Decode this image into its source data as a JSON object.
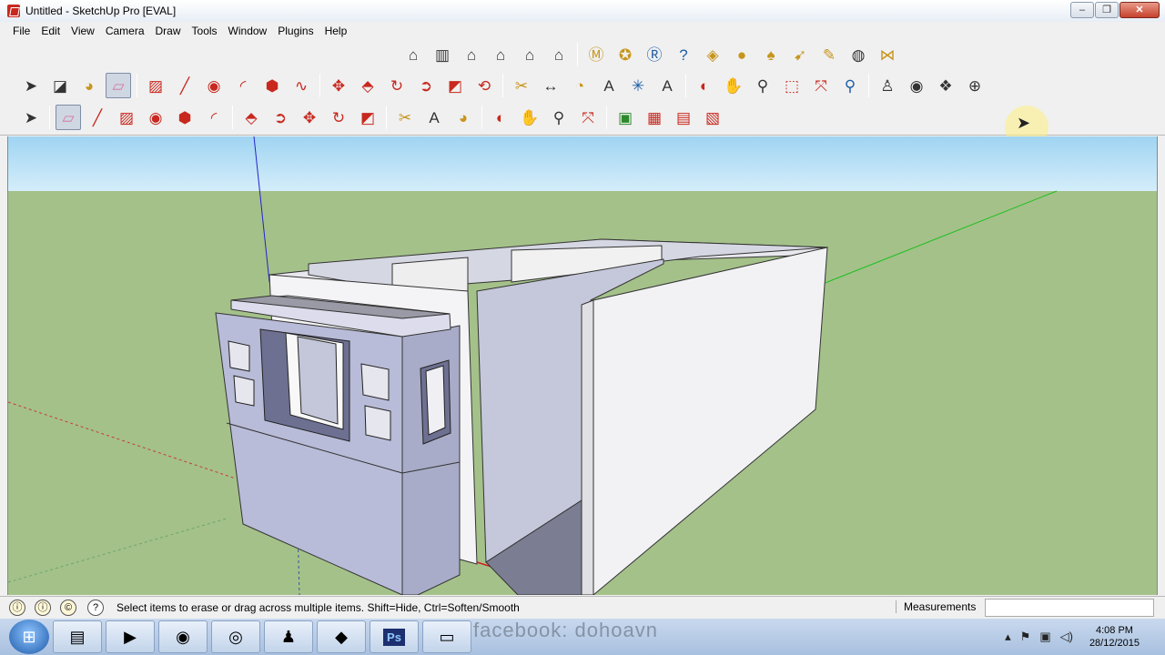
{
  "window": {
    "title": "Untitled - SketchUp Pro [EVAL]",
    "minimize": "–",
    "maximize": "❐",
    "close": "✕"
  },
  "menu": [
    "File",
    "Edit",
    "View",
    "Camera",
    "Draw",
    "Tools",
    "Window",
    "Plugins",
    "Help"
  ],
  "toolbar_top": [
    {
      "icon": "warehouse-icon",
      "glyph": "⌂",
      "c": "ic-dark"
    },
    {
      "icon": "component-icon",
      "glyph": "▥",
      "c": "ic-dark"
    },
    {
      "icon": "home-view-icon",
      "glyph": "⌂",
      "c": "ic-dark"
    },
    {
      "icon": "front-view-icon",
      "glyph": "⌂",
      "c": "ic-dark"
    },
    {
      "icon": "back-view-icon",
      "glyph": "⌂",
      "c": "ic-dark"
    },
    {
      "icon": "side-view-icon",
      "glyph": "⌂",
      "c": "ic-dark"
    },
    "sep",
    {
      "icon": "m-plugin-icon",
      "glyph": "Ⓜ",
      "c": "ic-gold"
    },
    {
      "icon": "tag-plugin-icon",
      "glyph": "✪",
      "c": "ic-gold"
    },
    {
      "icon": "r-plugin-icon",
      "glyph": "Ⓡ",
      "c": "ic-blue"
    },
    {
      "icon": "help-plugin-icon",
      "glyph": "?",
      "c": "ic-blue"
    },
    {
      "icon": "label-plugin-icon",
      "glyph": "◈",
      "c": "ic-gold"
    },
    {
      "icon": "sun-plugin-icon",
      "glyph": "●",
      "c": "ic-gold"
    },
    {
      "icon": "lamp-plugin-icon",
      "glyph": "♠",
      "c": "ic-gold"
    },
    {
      "icon": "pointer-plugin-icon",
      "glyph": "➹",
      "c": "ic-gold"
    },
    {
      "icon": "light-plugin-icon",
      "glyph": "✎",
      "c": "ic-gold"
    },
    {
      "icon": "sphere-plugin-icon",
      "glyph": "◍",
      "c": "ic-dark"
    },
    {
      "icon": "bridge-plugin-icon",
      "glyph": "⋈",
      "c": "ic-gold"
    }
  ],
  "toolbar_main": [
    {
      "icon": "select-arrow-icon",
      "glyph": "➤",
      "c": "ic-dark"
    },
    {
      "icon": "make-component-icon",
      "glyph": "◪",
      "c": "ic-dark"
    },
    {
      "icon": "paint-bucket-icon",
      "glyph": "◕",
      "c": "ic-gold"
    },
    {
      "icon": "eraser-icon",
      "glyph": "▱",
      "c": "ic-pink",
      "active": true
    },
    "sep",
    {
      "icon": "rectangle-icon",
      "glyph": "▨",
      "c": "ic-red"
    },
    {
      "icon": "pencil-line-icon",
      "glyph": "╱",
      "c": "ic-red"
    },
    {
      "icon": "circle-icon",
      "glyph": "◉",
      "c": "ic-red"
    },
    {
      "icon": "arc-icon",
      "glyph": "◜",
      "c": "ic-red"
    },
    {
      "icon": "polygon-icon",
      "glyph": "⬢",
      "c": "ic-red"
    },
    {
      "icon": "freehand-icon",
      "glyph": "∿",
      "c": "ic-red"
    },
    "sep",
    {
      "icon": "move-icon",
      "glyph": "✥",
      "c": "ic-red"
    },
    {
      "icon": "push-pull-icon",
      "glyph": "⬘",
      "c": "ic-red"
    },
    {
      "icon": "rotate-icon",
      "glyph": "↻",
      "c": "ic-red"
    },
    {
      "icon": "follow-me-icon",
      "glyph": "➲",
      "c": "ic-red"
    },
    {
      "icon": "scale-icon",
      "glyph": "◩",
      "c": "ic-red"
    },
    {
      "icon": "offset-icon",
      "glyph": "⟲",
      "c": "ic-red"
    },
    "sep",
    {
      "icon": "tape-measure-icon",
      "glyph": "✂",
      "c": "ic-gold"
    },
    {
      "icon": "dimension-icon",
      "glyph": "↔",
      "c": "ic-dark"
    },
    {
      "icon": "protractor-icon",
      "glyph": "◔",
      "c": "ic-gold"
    },
    {
      "icon": "text-icon",
      "glyph": "A",
      "c": "ic-dark"
    },
    {
      "icon": "axes-icon",
      "glyph": "✳",
      "c": "ic-blue"
    },
    {
      "icon": "3d-text-icon",
      "glyph": "A",
      "c": "ic-dark"
    },
    "sep",
    {
      "icon": "orbit-icon",
      "glyph": "◐",
      "c": "ic-red"
    },
    {
      "icon": "pan-icon",
      "glyph": "✋",
      "c": "ic-dark"
    },
    {
      "icon": "zoom-icon",
      "glyph": "⚲",
      "c": "ic-dark"
    },
    {
      "icon": "zoom-window-icon",
      "glyph": "⬚",
      "c": "ic-red"
    },
    {
      "icon": "zoom-extents-icon",
      "glyph": "⤧",
      "c": "ic-red"
    },
    {
      "icon": "previous-view-icon",
      "glyph": "⚲",
      "c": "ic-blue"
    },
    "sep",
    {
      "icon": "position-camera-icon",
      "glyph": "♙",
      "c": "ic-dark"
    },
    {
      "icon": "look-around-icon",
      "glyph": "◉",
      "c": "ic-dark"
    },
    {
      "icon": "walk-icon",
      "glyph": "❖",
      "c": "ic-dark"
    },
    {
      "icon": "section-plane-icon",
      "glyph": "⊕",
      "c": "ic-dark"
    }
  ],
  "toolbar_large": [
    {
      "icon": "select-arrow-icon",
      "glyph": "➤",
      "c": "ic-dark"
    },
    "sep",
    {
      "icon": "eraser-icon",
      "glyph": "▱",
      "c": "ic-pink",
      "active": true
    },
    {
      "icon": "pencil-line-icon",
      "glyph": "╱",
      "c": "ic-red"
    },
    {
      "icon": "rectangle-icon",
      "glyph": "▨",
      "c": "ic-red"
    },
    {
      "icon": "circle-icon",
      "glyph": "◉",
      "c": "ic-red"
    },
    {
      "icon": "polygon-icon",
      "glyph": "⬢",
      "c": "ic-red"
    },
    {
      "icon": "arc-icon",
      "glyph": "◜",
      "c": "ic-red"
    },
    "sep",
    {
      "icon": "push-pull-icon",
      "glyph": "⬘",
      "c": "ic-red"
    },
    {
      "icon": "follow-me-icon",
      "glyph": "➲",
      "c": "ic-red"
    },
    {
      "icon": "move-icon",
      "glyph": "✥",
      "c": "ic-red"
    },
    {
      "icon": "rotate-icon",
      "glyph": "↻",
      "c": "ic-red"
    },
    {
      "icon": "scale-icon",
      "glyph": "◩",
      "c": "ic-red"
    },
    "sep",
    {
      "icon": "tape-measure-icon",
      "glyph": "✂",
      "c": "ic-gold"
    },
    {
      "icon": "text-icon",
      "glyph": "A",
      "c": "ic-dark"
    },
    {
      "icon": "paint-bucket-icon",
      "glyph": "◕",
      "c": "ic-gold"
    },
    "sep",
    {
      "icon": "orbit-icon",
      "glyph": "◐",
      "c": "ic-red"
    },
    {
      "icon": "pan-icon",
      "glyph": "✋",
      "c": "ic-dark"
    },
    {
      "icon": "zoom-icon",
      "glyph": "⚲",
      "c": "ic-dark"
    },
    {
      "icon": "zoom-extents-icon",
      "glyph": "⤧",
      "c": "ic-red"
    },
    "sep",
    {
      "icon": "get-models-icon",
      "glyph": "▣",
      "c": "ic-green"
    },
    {
      "icon": "share-model-icon",
      "glyph": "▦",
      "c": "ic-red"
    },
    {
      "icon": "share-component-icon",
      "glyph": "▤",
      "c": "ic-red"
    },
    {
      "icon": "extension-warehouse-icon",
      "glyph": "▧",
      "c": "ic-red"
    }
  ],
  "status": {
    "text": "Select items to erase or drag across multiple items. Shift=Hide, Ctrl=Soften/Smooth",
    "measurements_label": "Measurements",
    "measurements_value": ""
  },
  "taskbar": {
    "apps": [
      {
        "icon": "explorer-folder-icon",
        "glyph": "▤"
      },
      {
        "icon": "media-player-icon",
        "glyph": "▶"
      },
      {
        "icon": "firefox-icon",
        "glyph": "◉"
      },
      {
        "icon": "chrome-icon",
        "glyph": "◎"
      },
      {
        "icon": "user-app-icon",
        "glyph": "♟"
      },
      {
        "icon": "sketchup-icon",
        "glyph": "◆"
      },
      {
        "icon": "photoshop-icon",
        "glyph": "Ps"
      },
      {
        "icon": "image-viewer-icon",
        "glyph": "▭"
      }
    ],
    "watermark": "facebook: dohoavn",
    "time": "4:08 PM",
    "date": "28/12/2015"
  }
}
